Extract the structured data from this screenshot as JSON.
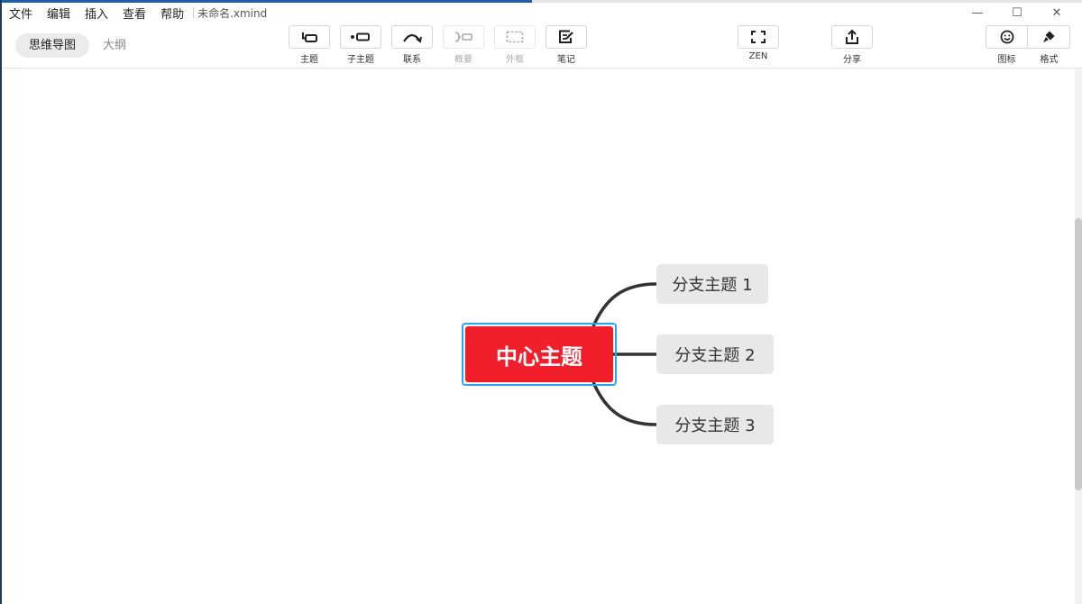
{
  "menubar": {
    "items": [
      {
        "label": "文件"
      },
      {
        "label": "编辑"
      },
      {
        "label": "插入"
      },
      {
        "label": "查看"
      },
      {
        "label": "帮助"
      }
    ],
    "filename": "未命名.xmind"
  },
  "window_controls": {
    "minimize": "—",
    "maximize": "☐",
    "close": "✕"
  },
  "view_tabs": [
    {
      "label": "思维导图",
      "active": true
    },
    {
      "label": "大纲",
      "active": false
    }
  ],
  "toolbar": {
    "topic": {
      "label": "主题",
      "icon": "topic-icon"
    },
    "subtopic": {
      "label": "子主题",
      "icon": "subtopic-icon"
    },
    "relationship": {
      "label": "联系",
      "icon": "relationship-icon"
    },
    "summary": {
      "label": "概要",
      "icon": "summary-icon",
      "disabled": true
    },
    "boundary": {
      "label": "外框",
      "icon": "boundary-icon",
      "disabled": true
    },
    "notes": {
      "label": "笔记",
      "icon": "notes-icon"
    },
    "zen": {
      "label": "ZEN",
      "icon": "fullscreen-icon"
    },
    "share": {
      "label": "分享",
      "icon": "share-icon"
    },
    "icons_panel": {
      "label": "图标",
      "icon": "smiley-icon"
    },
    "format": {
      "label": "格式",
      "icon": "brush-icon"
    }
  },
  "mindmap": {
    "central_topic": "中心主题",
    "branches": [
      {
        "label": "分支主题 1"
      },
      {
        "label": "分支主题 2"
      },
      {
        "label": "分支主题 3"
      }
    ]
  },
  "colors": {
    "central_fill": "#f01f2b",
    "selection": "#2aa4f4",
    "branch_fill": "#e8e8e8",
    "connector": "#333333"
  }
}
